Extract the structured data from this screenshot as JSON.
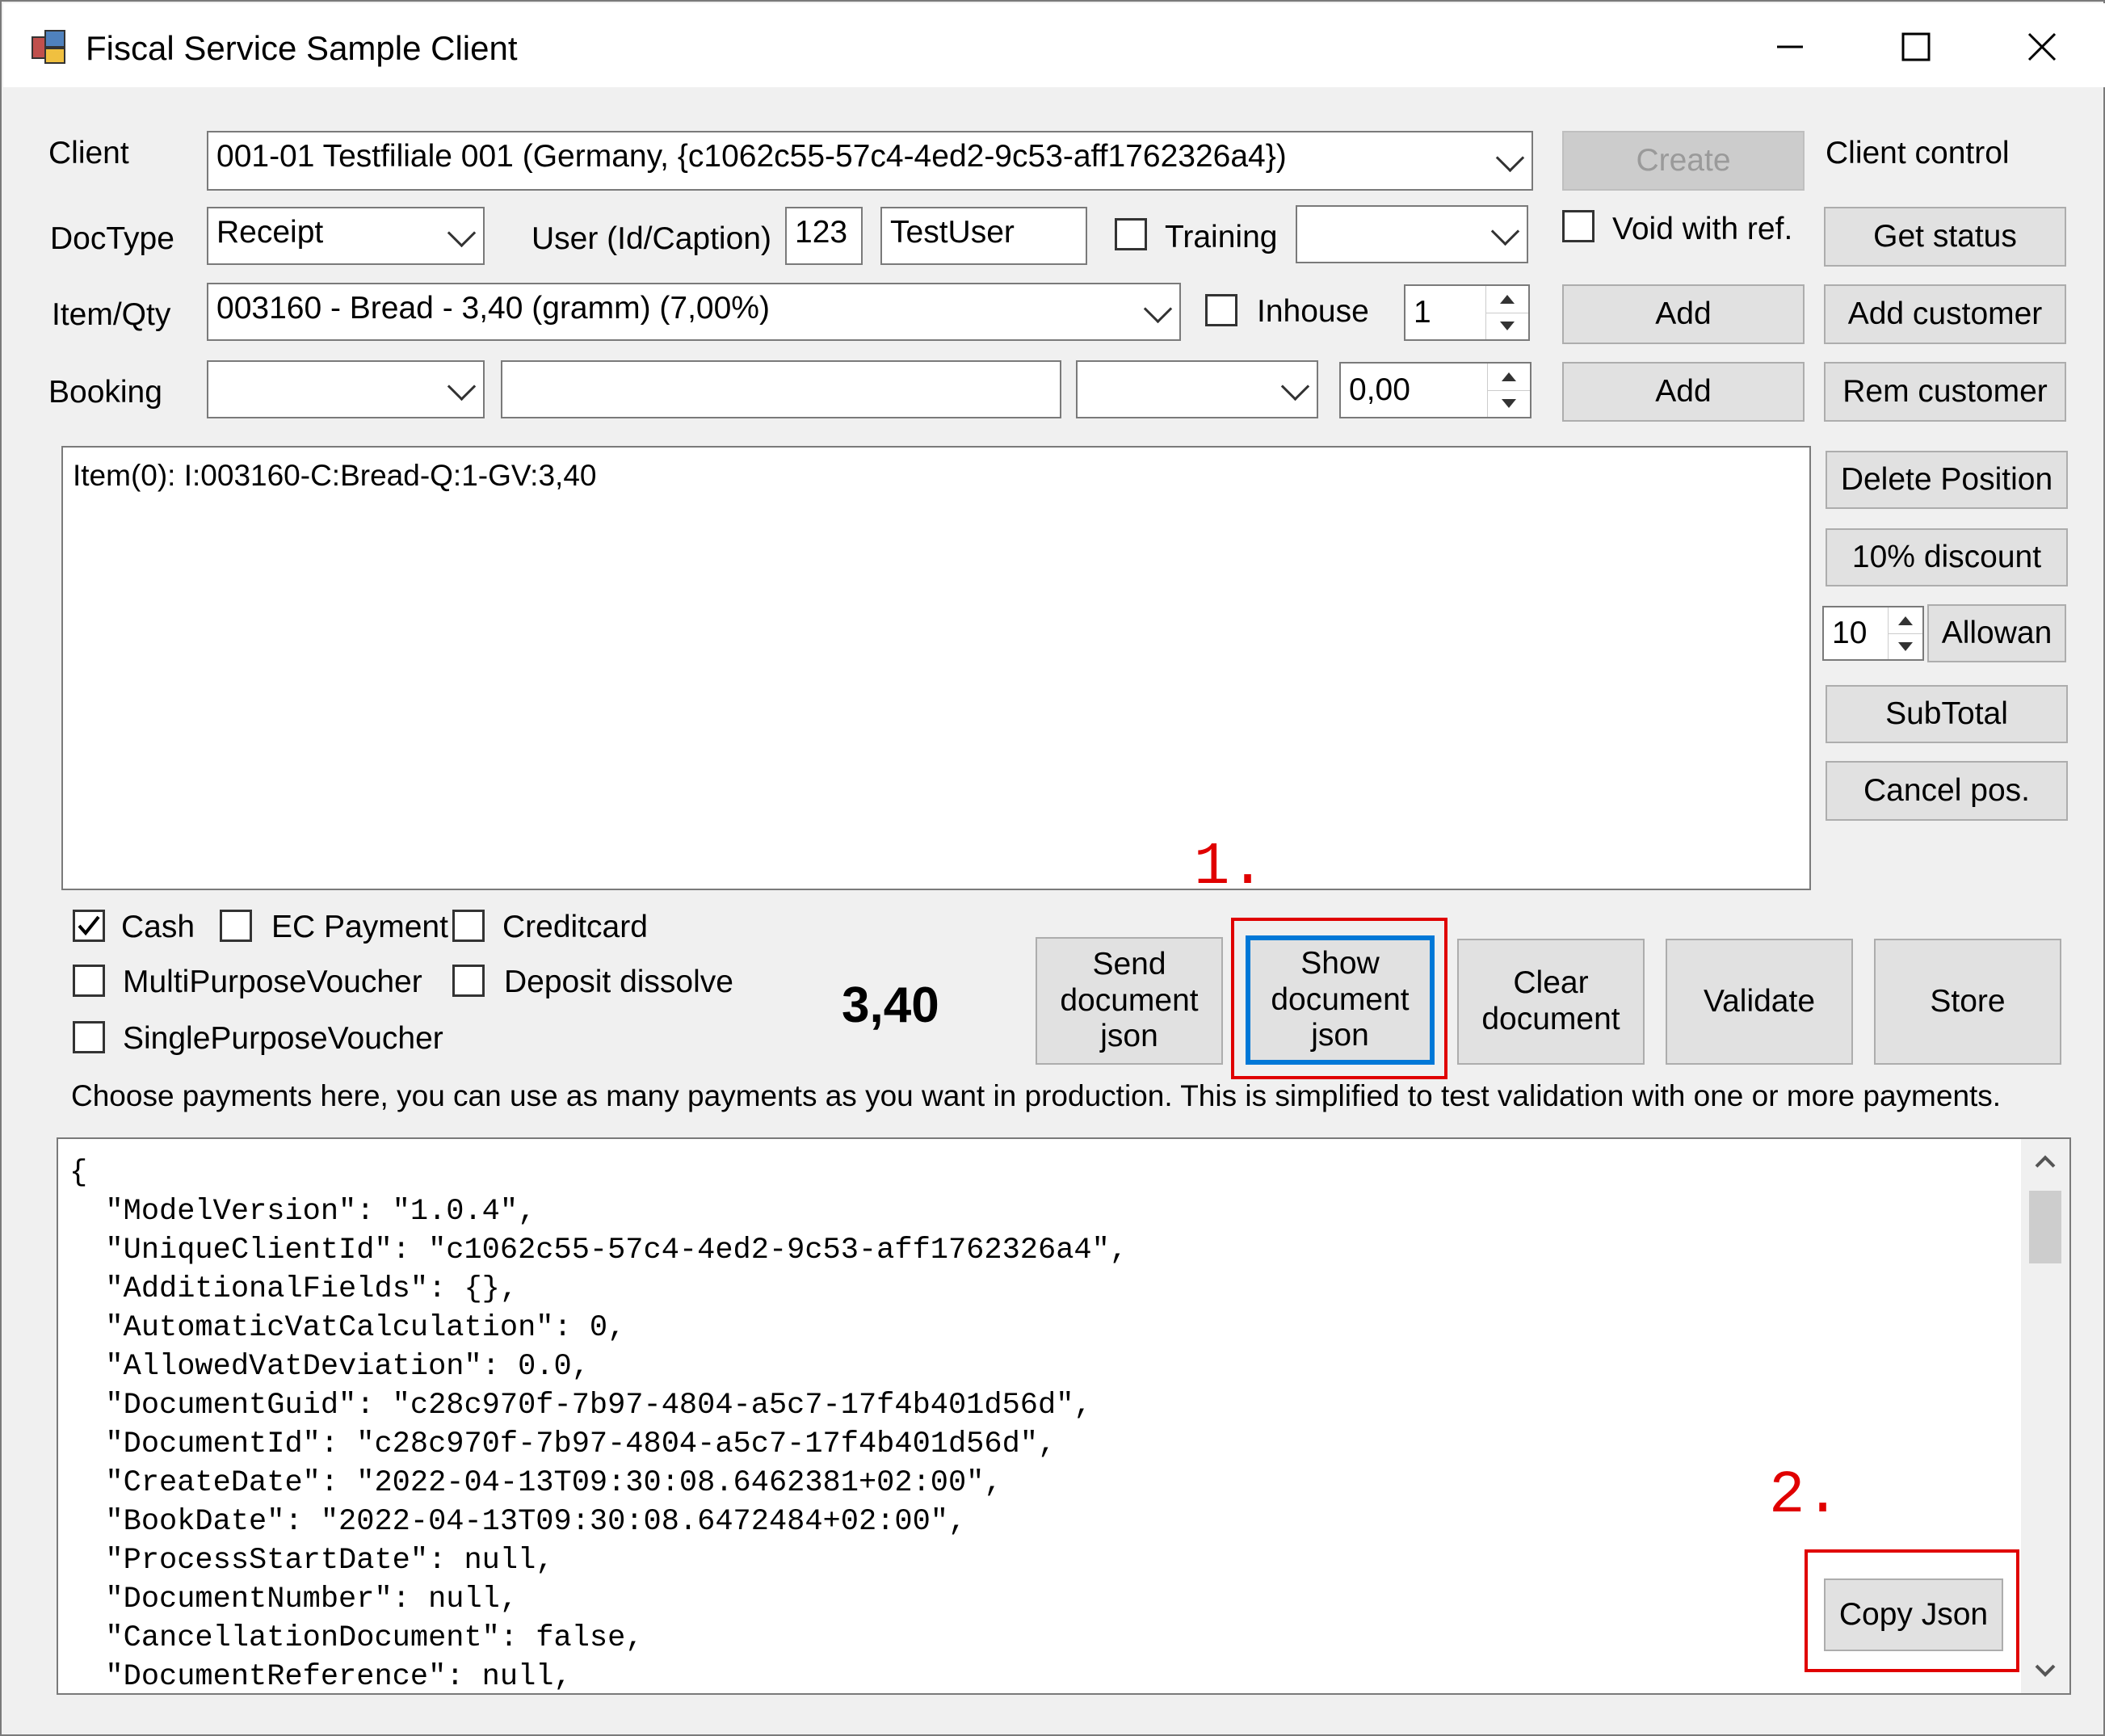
{
  "window": {
    "title": "Fiscal Service Sample Client",
    "minimize_icon": "minimize-icon",
    "maximize_icon": "maximize-icon",
    "close_icon": "close-icon"
  },
  "client": {
    "label": "Client",
    "value": "001-01 Testfiliale 001 (Germany, {c1062c55-57c4-4ed2-9c53-aff1762326a4})",
    "create_label": "Create",
    "client_control_label": "Client control"
  },
  "doctype": {
    "label": "DocType",
    "value": "Receipt",
    "user_label": "User (Id/Caption)",
    "user_id": "123",
    "user_caption": "TestUser",
    "training_label": "Training",
    "training_checked": false,
    "training_select": "",
    "void_label": "Void with ref.",
    "void_checked": false,
    "get_status_label": "Get status"
  },
  "item": {
    "label": "Item/Qty",
    "value": "003160 - Bread - 3,40 (gramm) (7,00%)",
    "inhouse_label": "Inhouse",
    "inhouse_checked": false,
    "qty": "1",
    "add_label": "Add",
    "add_customer_label": "Add customer"
  },
  "booking": {
    "label": "Booking",
    "select1": "",
    "text": "",
    "select2": "",
    "amount": "0,00",
    "add_label": "Add",
    "rem_customer_label": "Rem customer"
  },
  "positions": {
    "items": [
      "Item(0): I:003160-C:Bread-Q:1-GV:3,40"
    ]
  },
  "side_buttons": {
    "delete_position": "Delete Position",
    "discount": "10% discount",
    "allowance_value": "10",
    "allowance_label": "Allowan",
    "subtotal": "SubTotal",
    "cancel_pos": "Cancel pos."
  },
  "payments": {
    "cash": "Cash",
    "cash_checked": true,
    "ec": "EC Payment",
    "creditcard": "Creditcard",
    "multi": "MultiPurposeVoucher",
    "deposit": "Deposit dissolve",
    "single": "SinglePurposeVoucher",
    "total": "3,40",
    "hint": "Choose payments here, you can use as many payments as you want in production. This is simplified to test validation with one or more payments."
  },
  "actions": {
    "send_json": "Send document json",
    "show_json": "Show document json",
    "clear": "Clear document",
    "validate": "Validate",
    "store": "Store",
    "copy_json": "Copy Json"
  },
  "annotations": {
    "step1": "1.",
    "step2": "2.",
    "highlight_color": "#e00000"
  },
  "json_output": {
    "lines": [
      "{",
      "  \"ModelVersion\": \"1.0.4\",",
      "  \"UniqueClientId\": \"c1062c55-57c4-4ed2-9c53-aff1762326a4\",",
      "  \"AdditionalFields\": {},",
      "  \"AutomaticVatCalculation\": 0,",
      "  \"AllowedVatDeviation\": 0.0,",
      "  \"DocumentGuid\": \"c28c970f-7b97-4804-a5c7-17f4b401d56d\",",
      "  \"DocumentId\": \"c28c970f-7b97-4804-a5c7-17f4b401d56d\",",
      "  \"CreateDate\": \"2022-04-13T09:30:08.6462381+02:00\",",
      "  \"BookDate\": \"2022-04-13T09:30:08.6472484+02:00\",",
      "  \"ProcessStartDate\": null,",
      "  \"DocumentNumber\": null,",
      "  \"CancellationDocument\": false,",
      "  \"DocumentReference\": null,"
    ]
  }
}
